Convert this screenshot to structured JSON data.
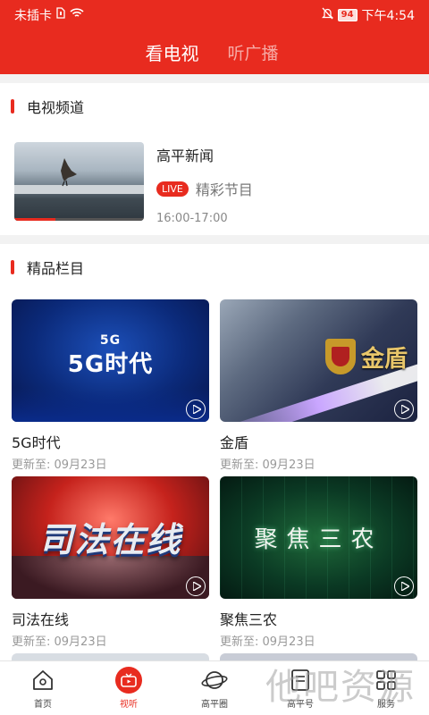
{
  "status_bar": {
    "carrier": "未插卡",
    "battery": "94",
    "time": "下午4:54"
  },
  "header": {
    "tabs": [
      {
        "label": "看电视",
        "active": true
      },
      {
        "label": "听广播",
        "active": false
      }
    ],
    "accent_color": "#e82b1f"
  },
  "tv_section": {
    "title": "电视频道",
    "channel": {
      "name": "高平新闻",
      "live_label": "LIVE",
      "program": "精彩节目",
      "time": "16:00-17:00",
      "progress": 0.32
    }
  },
  "featured_section": {
    "title": "精品栏目",
    "items": [
      {
        "name": "5G时代",
        "date": "更新至: 09月23日",
        "art_small": "5G",
        "art_big": "5G时代"
      },
      {
        "name": "金盾",
        "date": "更新至: 09月23日",
        "art_text": "金盾"
      },
      {
        "name": "司法在线",
        "date": "更新至: 09月23日",
        "art_text": "司法在线"
      },
      {
        "name": "聚焦三农",
        "date": "更新至: 09月23日",
        "art_text": "聚焦三农"
      }
    ]
  },
  "bottom_nav": {
    "items": [
      {
        "label": "首页",
        "icon": "home-icon",
        "active": false
      },
      {
        "label": "视听",
        "icon": "tv-icon",
        "active": true
      },
      {
        "label": "高平圈",
        "icon": "planet-icon",
        "active": false
      },
      {
        "label": "高平号",
        "icon": "document-icon",
        "active": false
      },
      {
        "label": "服务",
        "icon": "grid-icon",
        "active": false
      }
    ]
  },
  "watermark": "他吧资源"
}
